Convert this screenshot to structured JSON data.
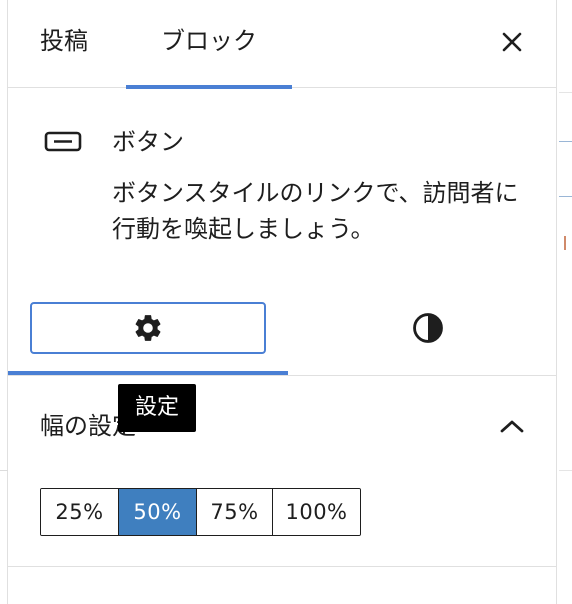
{
  "tabs": {
    "post": "投稿",
    "block": "ブロック",
    "close_icon": "close-icon"
  },
  "block": {
    "icon": "button-block-icon",
    "title": "ボタン",
    "description": "ボタンスタイルのリンクで、訪問者に行動を喚起しましょう。"
  },
  "style_tabs": {
    "settings_icon": "gear-icon",
    "styles_icon": "contrast-icon"
  },
  "tooltip": "設定",
  "width_settings": {
    "title": "幅の設定",
    "options": [
      "25%",
      "50%",
      "75%",
      "100%"
    ],
    "selected": "50%"
  },
  "colors": {
    "accent": "#4a7fd4",
    "selected_bg": "#3f7fbf",
    "text": "#1e1e1e"
  }
}
